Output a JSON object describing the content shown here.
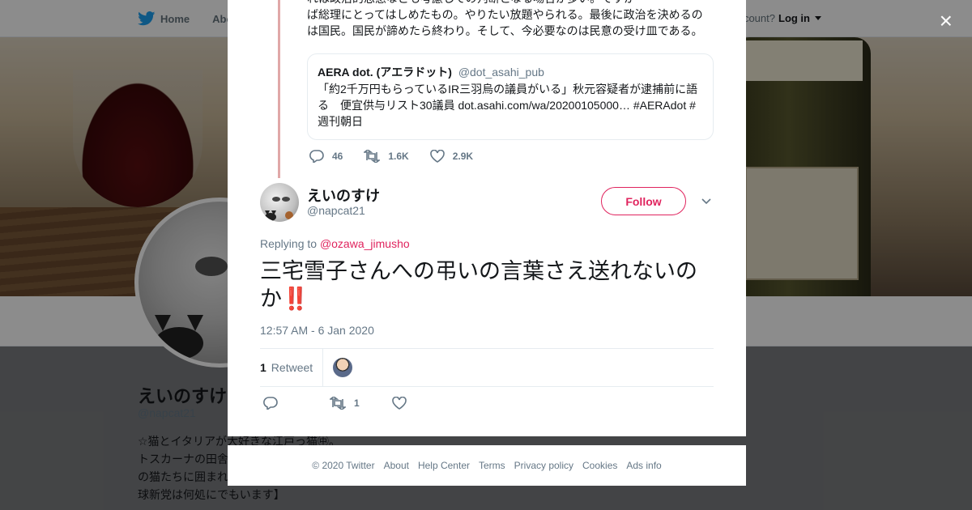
{
  "background": {
    "nav": {
      "home_label": "Home",
      "about_label": "Abo",
      "account_prompt": "ccount?",
      "login_label": "Log in"
    },
    "profile": {
      "name": "えいのすけ",
      "handle": "@napcat21",
      "bio_lines": [
        "☆猫とイタリアが大好きな江戸っ猫㊥。",
        "トスカーナの田舎",
        "の猫たちに囲まれ",
        "球新党は何処にでもいます】"
      ]
    }
  },
  "modal": {
    "close_label": "×",
    "parent_tweet": {
      "text_lines": [
        "れは政治的思惑なども考慮しての判断となる場合が多い。ですか",
        "ば総理にとってはしめたもの。やりたい放題やられる。最後に政治を決めるの",
        "は国民。国民が諦めたら終わり。そして、今必要なのは民意の受け皿である。"
      ],
      "quote": {
        "name": "AERA dot. (アエラドット)",
        "handle": "@dot_asahi_pub",
        "text": "「約2千万円もらっているIR三羽烏の議員がいる」秋元容疑者が逮捕前に語る　便宜供与リスト30議員 dot.asahi.com/wa/20200105000… #AERAdot #週刊朝日"
      },
      "replies": "46",
      "retweets": "1.6K",
      "likes": "2.9K"
    },
    "tweet": {
      "author_name": "えいのすけ",
      "author_handle": "@napcat21",
      "follow_label": "Follow",
      "replying_prefix": "Replying to",
      "replying_to": "@ozawa_jimusho",
      "text": "三宅雪子さんへの弔いの言葉さえ送れないのか",
      "emoji": "‼️",
      "timestamp": "12:57 AM - 6 Jan 2020",
      "retweet_count": "1",
      "retweet_label": "Retweet",
      "action_retweet_count": "1"
    }
  },
  "footer": {
    "links": [
      "© 2020 Twitter",
      "About",
      "Help Center",
      "Terms",
      "Privacy policy",
      "Cookies",
      "Ads info"
    ]
  },
  "colors": {
    "accent": "#e0245e",
    "muted": "#657786",
    "twitter_blue": "#1da1f2"
  }
}
